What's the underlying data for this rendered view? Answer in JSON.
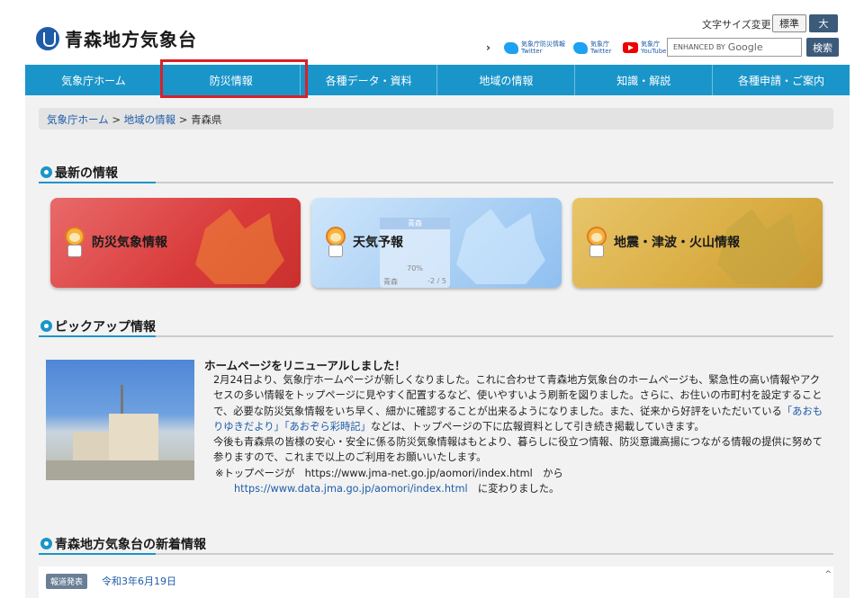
{
  "header": {
    "site_title": "青森地方気象台",
    "font_size_label": "文字サイズ変更",
    "font_size_standard": "標準",
    "font_size_large": "大",
    "sns": [
      {
        "icon": "twitter-icon",
        "line1": "気象庁防災情報",
        "line2": "Twitter"
      },
      {
        "icon": "twitter-icon",
        "line1": "気象庁",
        "line2": "Twitter"
      },
      {
        "icon": "youtube-icon",
        "line1": "気象庁",
        "line2": "YouTube"
      }
    ],
    "sns_arrow": "›",
    "search_prefix": "ENHANCED BY",
    "search_brand": "Google",
    "search_button": "検索"
  },
  "nav": {
    "items": [
      "気象庁ホーム",
      "防災情報",
      "各種データ・資料",
      "地域の情報",
      "知識・解説",
      "各種申請・ご案内"
    ],
    "highlighted_index": 1,
    "highlight_color": "#d8202a"
  },
  "breadcrumb": {
    "home": "気象庁ホーム",
    "region": "地域の情報",
    "current": "青森県",
    "separator": ">"
  },
  "latest": {
    "title": "最新の情報",
    "cards": [
      {
        "label": "防災気象情報",
        "color": "#d93b3b"
      },
      {
        "label": "天気予報",
        "color": "#a9cff4"
      },
      {
        "label": "地震・津波・火山情報",
        "color": "#d9ad43"
      }
    ],
    "weather_mini": {
      "region": "青森",
      "pop": "70%",
      "city": "青森",
      "temps": "-2 / 5"
    }
  },
  "pickup": {
    "title": "ピックアップ情報",
    "headline": "ホームページをリニューアルしました！",
    "para1_a": "2月24日より、気象庁ホームページが新しくなりました。これに合わせて青森地方気象台のホームページも、緊急性の高い情報やアクセスの多い情報をトップページに見やすく配置するなど、使いやすいよう刷新を図りました。さらに、お住いの市町村を設定することで、必要な防災気象情報をいち早く、細かに確認することが出来るようになりました。また、従来から好評をいただいている",
    "para1_link1": "「あおもりゆきだより」",
    "para1_link2": "「あおぞら彩時記」",
    "para1_b": "などは、トップページの下に広報資料として引き続き掲載していきます。",
    "para2": "今後も青森県の皆様の安心・安全に係る防災気象情報はもとより、暮らしに役立つ情報、防災意識高揚につながる情報の提供に努めて参りますので、これまで以上のご利用をお願いいたします。",
    "note_prefix": "※トップページが　https://www.jma-net.go.jp/aomori/index.html　から",
    "note_link": "https://www.data.jma.go.jp/aomori/index.html",
    "note_suffix": "　に変わりました。"
  },
  "news": {
    "title": "青森地方気象台の新着情報",
    "badge": "報道発表",
    "date": "令和3年6月19日",
    "scroll_icon": "^"
  }
}
